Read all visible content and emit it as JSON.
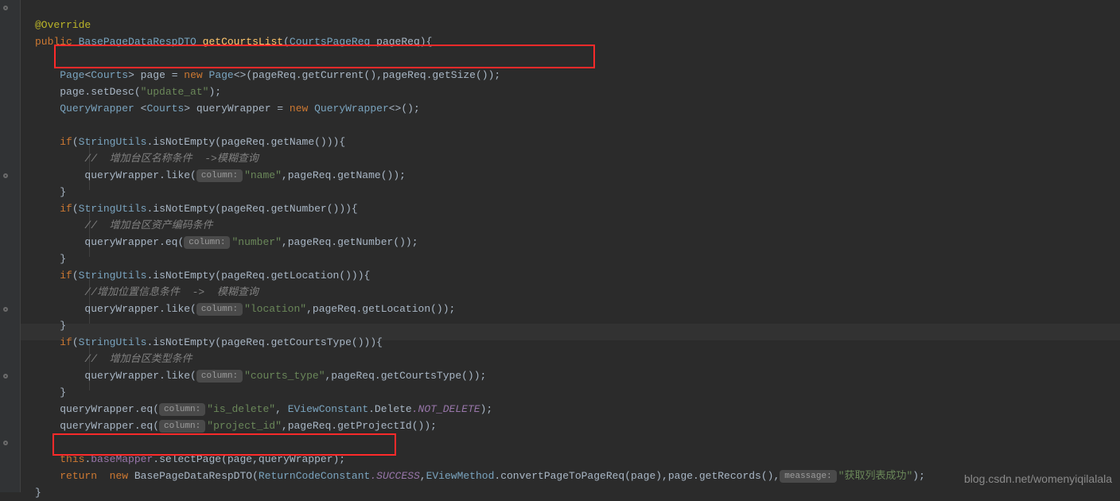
{
  "annotation": "@Override",
  "kw_public": "public",
  "type_resp": "BasePageDataRespDTO",
  "method_name": "getCourtsList",
  "param_type": "CourtsPageReq",
  "param_name": "pageReq",
  "type_page": "Page",
  "type_courts": "Courts",
  "var_page": "page",
  "kw_new": "new",
  "expr_page_ctor": "<>(pageReq.getCurrent(),pageReq.getSize());",
  "expr_setdesc_pre": "page.setDesc(",
  "str_update_at": "\"update_at\"",
  "type_qw": "QueryWrapper",
  "var_qw": "queryWrapper",
  "expr_qw_ctor": "<>();",
  "kw_if": "if",
  "type_su": "StringUtils",
  "fn_isnotempty": ".isNotEmpty",
  "expr_getName": "(pageReq.getName())){",
  "cmt_name": "//  增加台区名称条件  ->模糊查询",
  "hint_column": "column:",
  "str_name": "\"name\"",
  "expr_like_name": ",pageReq.getName());",
  "expr_getNumber": "(pageReq.getNumber())){",
  "cmt_number": "//  增加台区资产编码条件",
  "str_number": "\"number\"",
  "expr_eq_number": ",pageReq.getNumber());",
  "expr_getLocation": "(pageReq.getLocation())){",
  "cmt_location": "//增加位置信息条件  ->  模糊查询",
  "str_location": "\"location\"",
  "expr_like_location": ",pageReq.getLocation());",
  "expr_getCourtsType": "(pageReq.getCourtsType())){",
  "cmt_ctype": "//  增加台区类型条件",
  "str_ctype": "\"courts_type\"",
  "expr_like_ctype": ",pageReq.getCourtsType());",
  "str_isdelete": "\"is_delete\"",
  "type_eview": "EViewConstant",
  "const_delete": ".Delete",
  "const_notdelete": ".NOT_DELETE",
  "str_projid": "\"project_id\"",
  "expr_projid": ",pageReq.getProjectId());",
  "kw_this": "this",
  "field_basemapper": "baseMapper",
  "expr_selectpage": ".selectPage(page,queryWrapper);",
  "kw_return": "return",
  "type_retcode": "ReturnCodeConstant",
  "const_success": ".SUCCESS",
  "type_evmethod": "EViewMethod",
  "expr_convert": ".convertPageToPageReq(page),page.getRecords(),",
  "hint_meassage": "meassage:",
  "str_success": "\"获取列表成功\"",
  "close_paren_semi": ");",
  "close_brace": "}",
  "open_brace": "{",
  "watermark": "blog.csdn.net/womenyiqilalala"
}
